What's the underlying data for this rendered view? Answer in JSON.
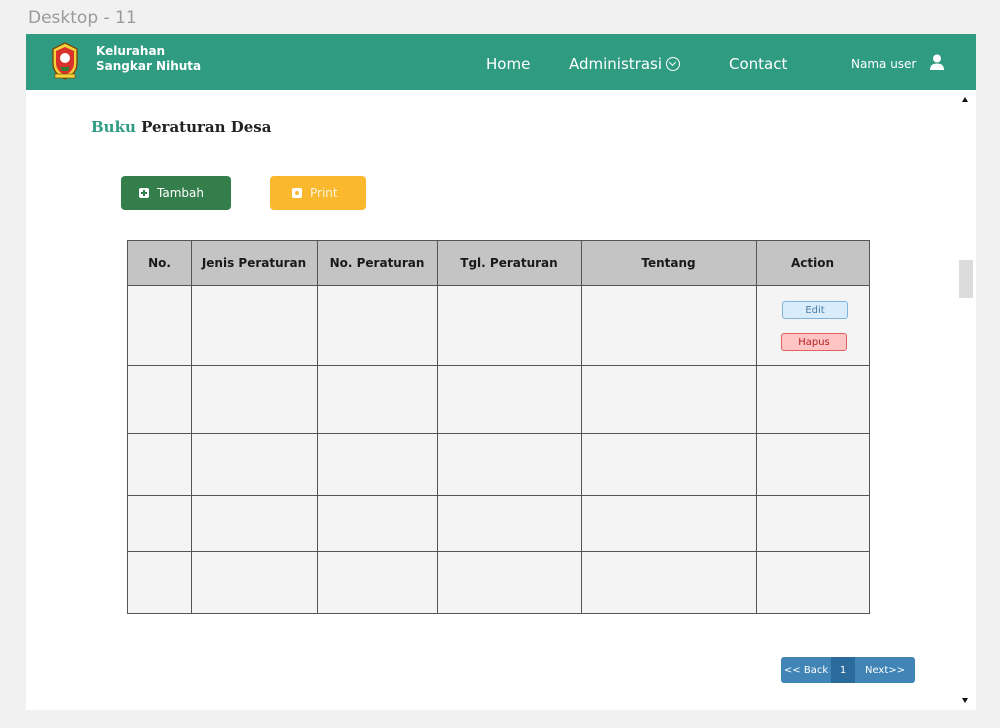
{
  "frame": {
    "label": "Desktop - 11"
  },
  "brand": {
    "line1": "Kelurahan",
    "line2": "Sangkar Nihuta",
    "logo_icon": "village-emblem-icon"
  },
  "nav": {
    "home": "Home",
    "administrasi": "Administrasi",
    "contact": "Contact",
    "user": "Nama user",
    "user_icon": "user-icon"
  },
  "page": {
    "title_accent": "Buku",
    "title_rest": "Peraturan Desa"
  },
  "toolbar": {
    "add_label": "Tambah",
    "print_label": "Print"
  },
  "table": {
    "columns": [
      "No.",
      "Jenis Peraturan",
      "No. Peraturan",
      "Tgl. Peraturan",
      "Tentang",
      "Action"
    ],
    "rows": [
      {
        "no": "",
        "jenis": "",
        "nomor": "",
        "tanggal": "",
        "tentang": ""
      },
      {
        "no": "",
        "jenis": "",
        "nomor": "",
        "tanggal": "",
        "tentang": ""
      },
      {
        "no": "",
        "jenis": "",
        "nomor": "",
        "tanggal": "",
        "tentang": ""
      },
      {
        "no": "",
        "jenis": "",
        "nomor": "",
        "tanggal": "",
        "tentang": ""
      },
      {
        "no": "",
        "jenis": "",
        "nomor": "",
        "tanggal": "",
        "tentang": ""
      }
    ],
    "edit_label": "Edit",
    "delete_label": "Hapus"
  },
  "pagination": {
    "back": "<< Back",
    "current": "1",
    "next": "Next>>"
  },
  "colors": {
    "primary": "#2f9c82",
    "add_button": "#347e4b",
    "print_button": "#f9b82d",
    "pager": "#4085b6",
    "table_header": "#c4c4c4"
  }
}
